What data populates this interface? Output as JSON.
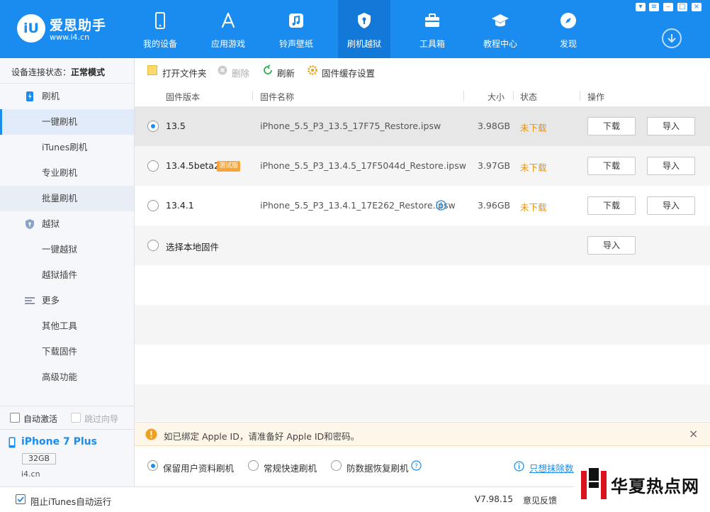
{
  "app": {
    "name": "爱思助手",
    "url": "www.i4.cn",
    "logo_badge": "iU"
  },
  "nav": [
    {
      "label": "我的设备",
      "icon": "phone-icon"
    },
    {
      "label": "应用游戏",
      "icon": "app-store-icon"
    },
    {
      "label": "铃声壁纸",
      "icon": "music-icon"
    },
    {
      "label": "刷机越狱",
      "icon": "shield-key-icon"
    },
    {
      "label": "工具箱",
      "icon": "toolbox-icon"
    },
    {
      "label": "教程中心",
      "icon": "graduation-cap-icon"
    },
    {
      "label": "发现",
      "icon": "compass-icon"
    }
  ],
  "sidebar": {
    "status_label": "设备连接状态：",
    "status_value": "正常模式",
    "items": [
      {
        "label": "刷机",
        "type": "head",
        "icon": "flash-icon"
      },
      {
        "label": "一键刷机",
        "type": "sub",
        "selected": true
      },
      {
        "label": "iTunes刷机",
        "type": "sub"
      },
      {
        "label": "专业刷机",
        "type": "sub"
      },
      {
        "label": "批量刷机",
        "type": "sub"
      },
      {
        "label": "越狱",
        "type": "head",
        "icon": "shield-icon"
      },
      {
        "label": "一键越狱",
        "type": "sub"
      },
      {
        "label": "越狱插件",
        "type": "sub"
      },
      {
        "label": "更多",
        "type": "head",
        "icon": "menu-icon"
      },
      {
        "label": "其他工具",
        "type": "sub"
      },
      {
        "label": "下载固件",
        "type": "sub"
      },
      {
        "label": "高级功能",
        "type": "sub"
      }
    ],
    "auto_activate": "自动激活",
    "skip_guide": "跳过向导",
    "device_name": "iPhone 7 Plus",
    "device_capacity": "32GB",
    "device_source": "i4.cn"
  },
  "toolbar": {
    "open_folder": "打开文件夹",
    "delete": "删除",
    "refresh": "刷新",
    "cache_settings": "固件缓存设置"
  },
  "table": {
    "headers": {
      "version": "固件版本",
      "name": "固件名称",
      "size": "大小",
      "status": "状态",
      "action": "操作"
    },
    "rows": [
      {
        "version": "13.5",
        "name": "iPhone_5.5_P3_13.5_17F75_Restore.ipsw",
        "size": "3.98GB",
        "status": "未下载",
        "download": "下载",
        "import": "导入",
        "selected": true
      },
      {
        "version": "13.4.5beta2",
        "badge": "测试版",
        "name": "iPhone_5.5_P3_13.4.5_17F5044d_Restore.ipsw",
        "size": "3.97GB",
        "status": "未下载",
        "download": "下载",
        "import": "导入"
      },
      {
        "version": "13.4.1",
        "name": "iPhone_5.5_P3_13.4.1_17E262_Restore.ipsw",
        "size": "3.96GB",
        "status": "未下载",
        "download": "下载",
        "import": "导入"
      }
    ],
    "local": {
      "label": "选择本地固件",
      "import": "导入"
    }
  },
  "notice": {
    "text": "如已绑定 Apple ID，请准备好 Apple ID和密码。"
  },
  "modes": {
    "keep_data": "保留用户资料刷机",
    "quick": "常规快速刷机",
    "anti_recovery": "防数据恢复刷机",
    "erase_link": "只想抹除数"
  },
  "footer": {
    "block_itunes": "阻止iTunes自动运行",
    "version": "V7.98.15",
    "feedback": "意见反馈"
  },
  "watermark": {
    "text": "华夏热点网"
  },
  "colors": {
    "brand": "#1a8cef",
    "warning": "#e8940a",
    "badge": "#f5a53a"
  }
}
